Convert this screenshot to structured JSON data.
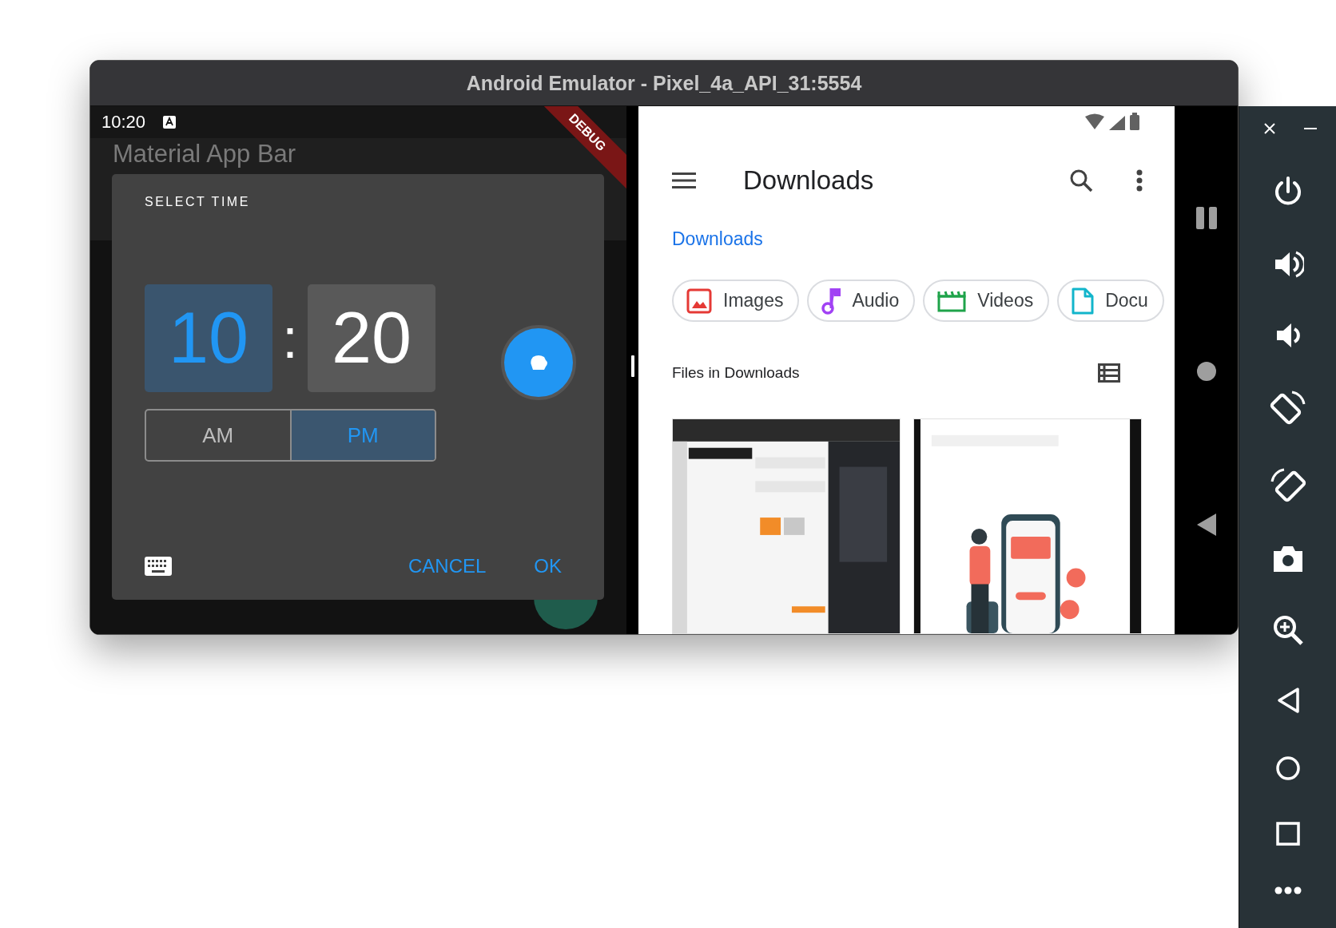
{
  "window": {
    "title": "Android Emulator - Pixel_4a_API_31:5554"
  },
  "left_app": {
    "status_bar": {
      "time": "10:20"
    },
    "app_bar": {
      "title": "Material App Bar"
    },
    "debug_banner": "DEBUG",
    "time_picker": {
      "heading": "SELECT TIME",
      "hour": {
        "value": "10",
        "selected": true
      },
      "separator": ":",
      "minute": {
        "value": "20",
        "selected": false
      },
      "periods": [
        {
          "label": "AM",
          "selected": false
        },
        {
          "label": "PM",
          "selected": true
        }
      ],
      "buttons": [
        {
          "label": "CANCEL"
        },
        {
          "label": "OK"
        }
      ]
    }
  },
  "right_app": {
    "app_bar": {
      "title": "Downloads"
    },
    "breadcrumb": "Downloads",
    "chips": [
      {
        "label": "Images",
        "kind": "images"
      },
      {
        "label": "Audio",
        "kind": "audio"
      },
      {
        "label": "Videos",
        "kind": "videos"
      },
      {
        "label": "Docu",
        "kind": "documents"
      }
    ],
    "section_title": "Files in Downloads"
  }
}
